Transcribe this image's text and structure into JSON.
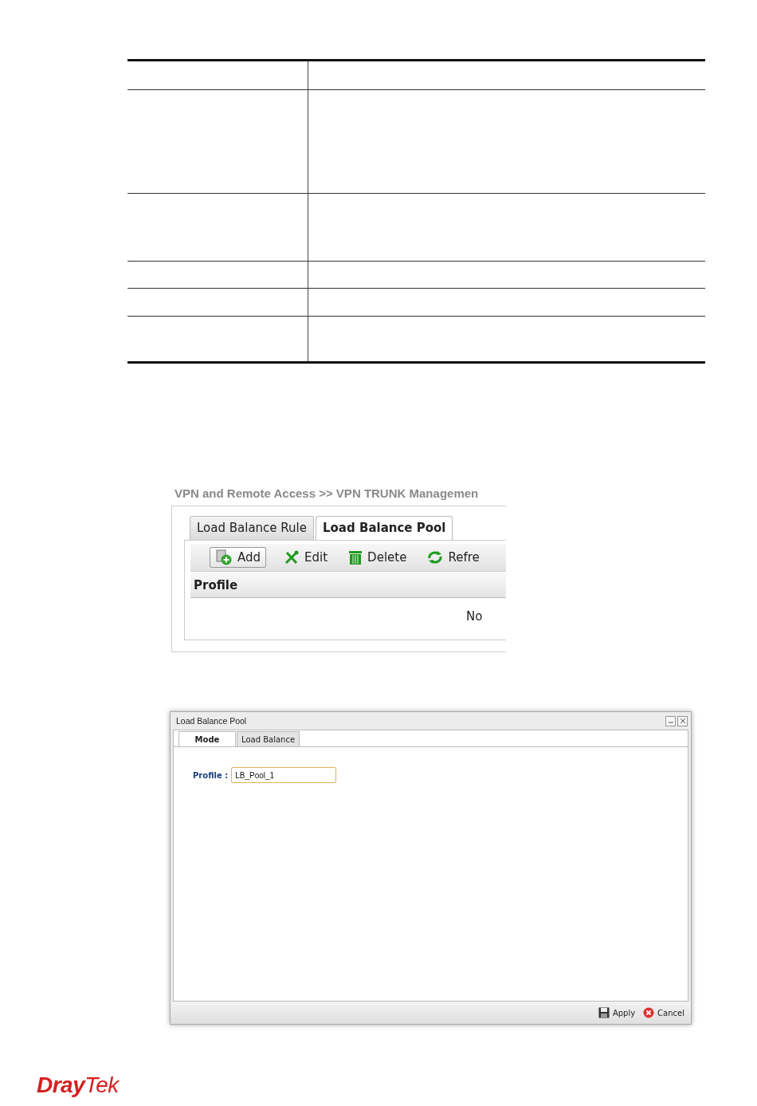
{
  "screenshot_1": {
    "breadcrumb": "VPN and Remote Access >> VPN TRUNK Managemen",
    "tabs": [
      {
        "label": "Load Balance Rule",
        "selected": false
      },
      {
        "label": "Load Balance Pool",
        "selected": true
      }
    ],
    "toolbar": [
      {
        "kind": "add",
        "label": "Add"
      },
      {
        "kind": "edit",
        "label": "Edit"
      },
      {
        "kind": "delete",
        "label": "Delete"
      },
      {
        "kind": "refresh",
        "label": "Refre"
      }
    ],
    "column": "Profile",
    "empty_text": "No"
  },
  "screenshot_2": {
    "window": {
      "title": "Load Balance Pool"
    },
    "tabs": [
      {
        "label": "Mode",
        "selected": true
      },
      {
        "label": "Load Balance",
        "selected": false
      }
    ],
    "field": {
      "label": "Profile :",
      "value": "LB_Pool_1"
    },
    "buttons": [
      {
        "kind": "apply",
        "label": "Apply"
      },
      {
        "kind": "cancel",
        "label": "Cancel"
      }
    ]
  },
  "logo": "**Dray**Tek"
}
